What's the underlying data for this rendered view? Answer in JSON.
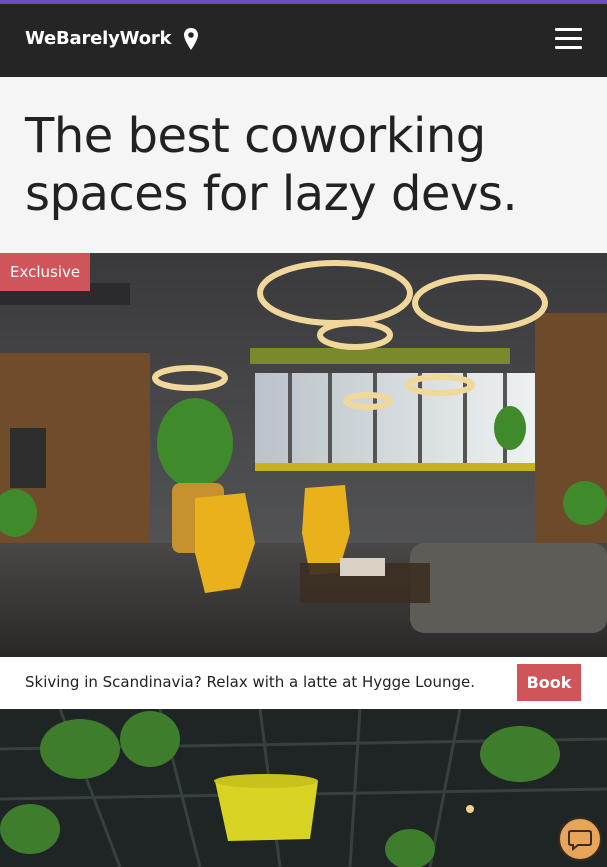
{
  "navbar": {
    "brand": "WeBarelyWork",
    "pin_icon": "map-pin-icon",
    "menu_icon": "hamburger-menu-icon"
  },
  "hero": {
    "title": "The best coworking spaces for lazy devs."
  },
  "listing": {
    "badge": "Exclusive",
    "caption": "Skiving in Scandinavia? Relax with a latte at Hygge Lounge.",
    "book_label": "Book"
  },
  "chat": {
    "icon": "chat-bubble-icon"
  },
  "colors": {
    "accent": "#d0555a",
    "navbar_bg": "#252525",
    "top_stripe": "#6b4fbe",
    "chat_button": "#e6a55a"
  }
}
